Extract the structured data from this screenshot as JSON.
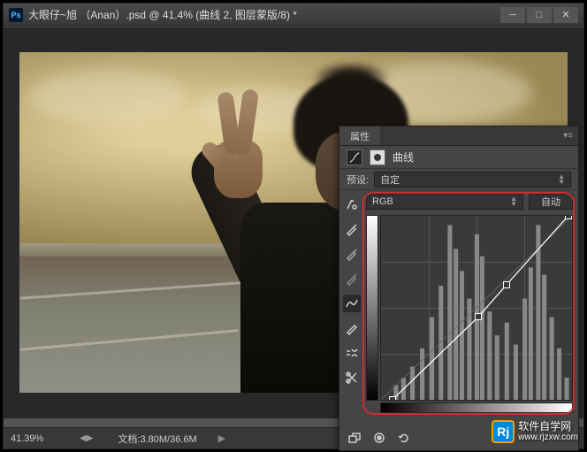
{
  "title": "大眼仔~旭 （Anan）.psd @ 41.4% (曲线 2, 图层蒙版/8) *",
  "status": {
    "zoom": "41.39%",
    "doc": "文档:3.80M/36.6M"
  },
  "panel": {
    "tab": "属性",
    "title": "曲线",
    "preset_label": "预设:",
    "preset_value": "自定",
    "channel": "RGB",
    "auto": "自动"
  },
  "watermark": {
    "name": "软件自学网",
    "url": "www.rjzxw.com",
    "logo": "Rj"
  },
  "chart_data": {
    "type": "curves",
    "channel": "RGB",
    "x_range": [
      0,
      255
    ],
    "y_range": [
      0,
      255
    ],
    "control_points": [
      {
        "x": 15,
        "y": 0
      },
      {
        "x": 130,
        "y": 115
      },
      {
        "x": 168,
        "y": 160
      },
      {
        "x": 250,
        "y": 255
      }
    ],
    "histogram_peaks": [
      {
        "x": 20,
        "h": 8
      },
      {
        "x": 30,
        "h": 12
      },
      {
        "x": 42,
        "h": 18
      },
      {
        "x": 55,
        "h": 28
      },
      {
        "x": 68,
        "h": 45
      },
      {
        "x": 80,
        "h": 62
      },
      {
        "x": 92,
        "h": 95
      },
      {
        "x": 100,
        "h": 82
      },
      {
        "x": 108,
        "h": 70
      },
      {
        "x": 118,
        "h": 55
      },
      {
        "x": 128,
        "h": 90
      },
      {
        "x": 135,
        "h": 78
      },
      {
        "x": 145,
        "h": 48
      },
      {
        "x": 155,
        "h": 35
      },
      {
        "x": 168,
        "h": 42
      },
      {
        "x": 180,
        "h": 30
      },
      {
        "x": 192,
        "h": 55
      },
      {
        "x": 200,
        "h": 72
      },
      {
        "x": 210,
        "h": 95
      },
      {
        "x": 218,
        "h": 68
      },
      {
        "x": 228,
        "h": 45
      },
      {
        "x": 238,
        "h": 28
      },
      {
        "x": 248,
        "h": 12
      }
    ]
  }
}
